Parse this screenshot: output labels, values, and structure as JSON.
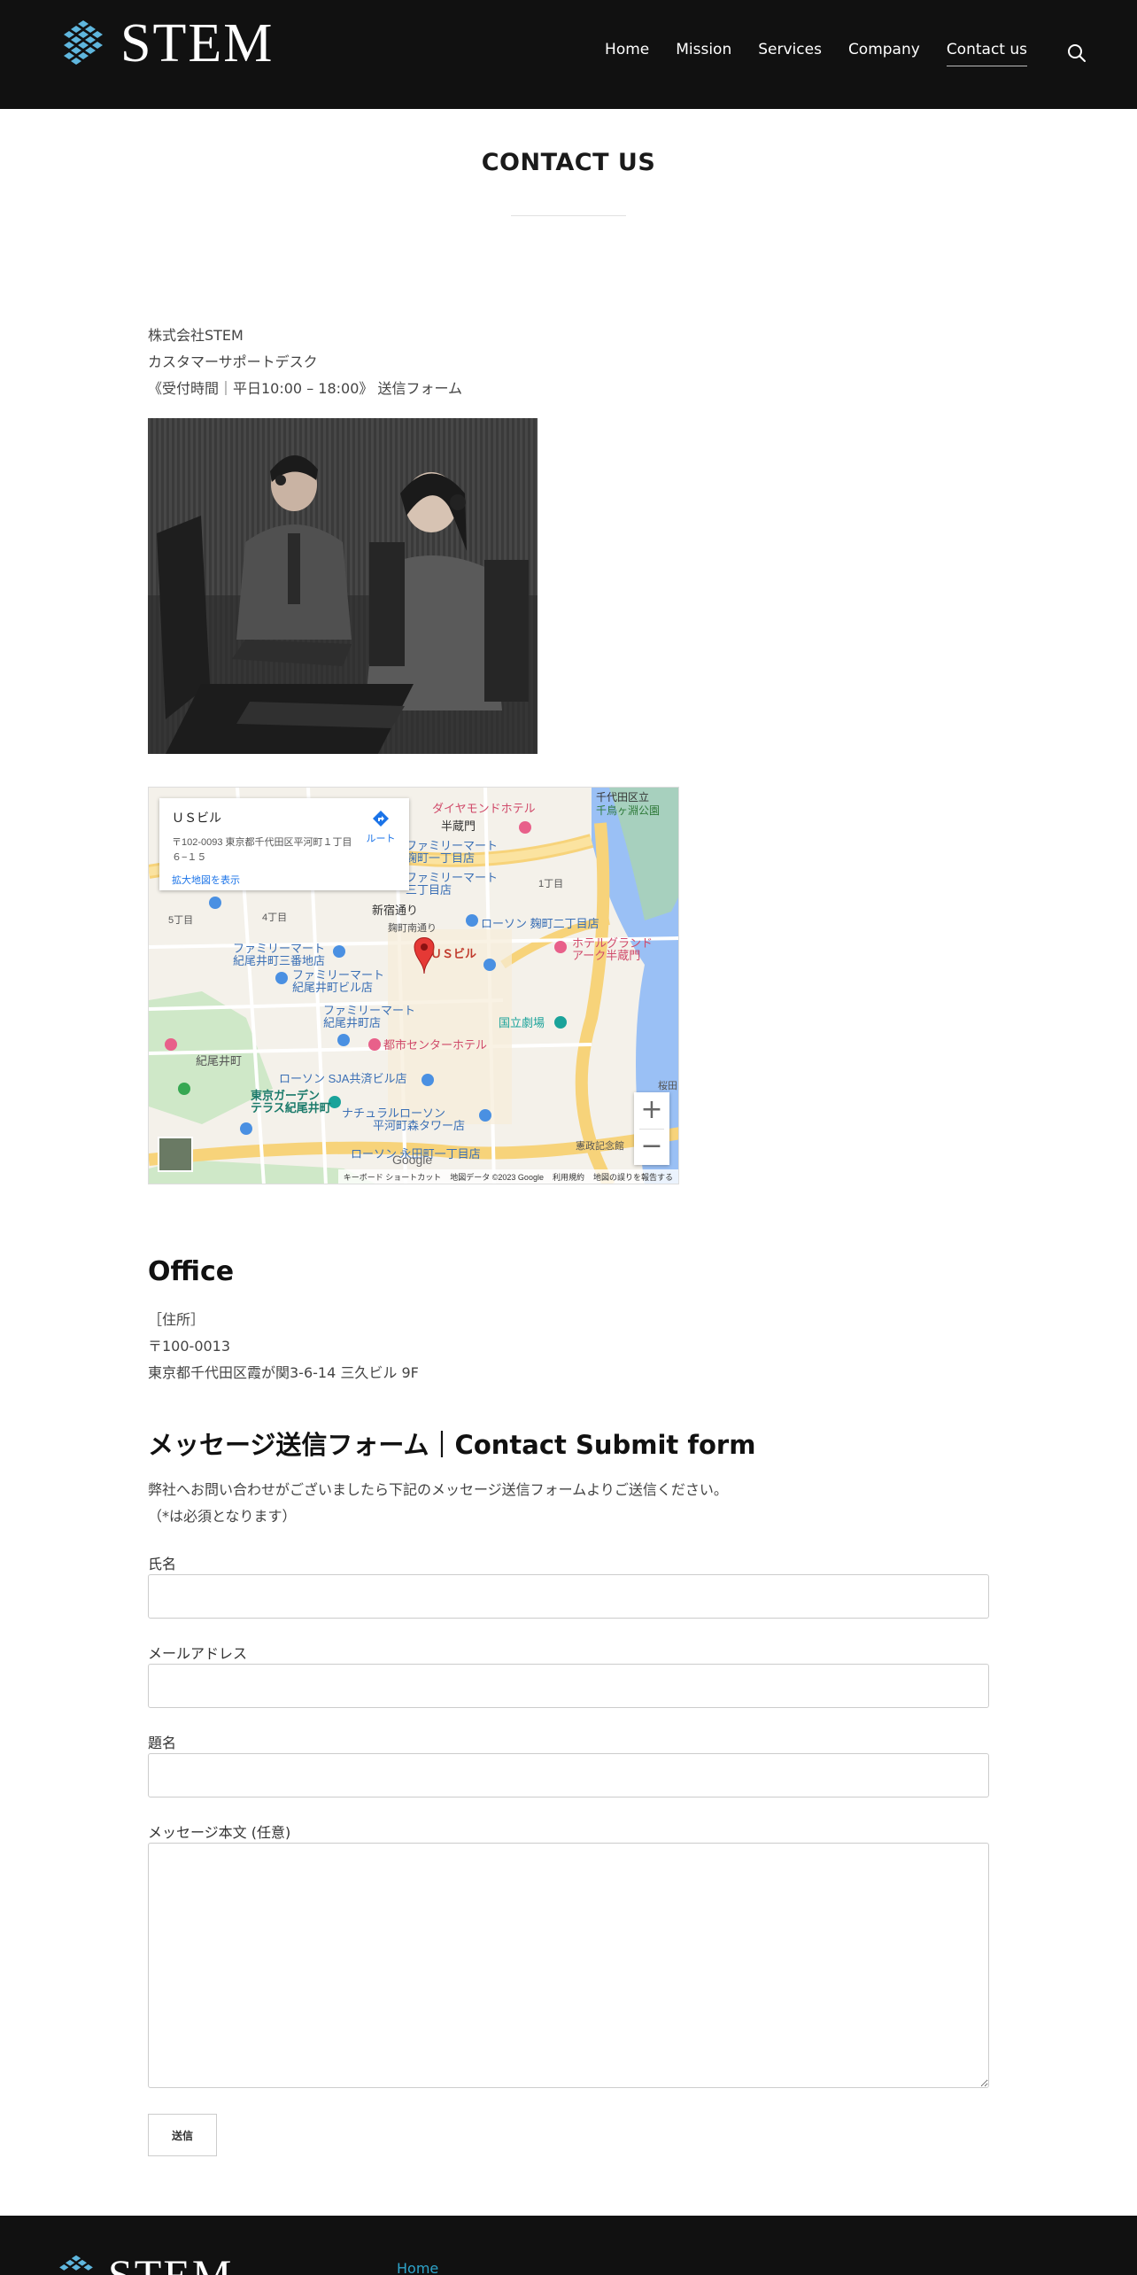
{
  "header": {
    "logo_text": "STEM",
    "nav": [
      {
        "label": "Home"
      },
      {
        "label": "Mission"
      },
      {
        "label": "Services"
      },
      {
        "label": "Company"
      },
      {
        "label": "Contact us",
        "active": true
      }
    ]
  },
  "page": {
    "title": "CONTACT US"
  },
  "intro": {
    "company": "株式会社STEM",
    "desk": "カスタマーサポートデスク",
    "hours": "《受付時間｜平日10:00 – 18:00》 送信フォーム"
  },
  "map": {
    "place_name": "ＵＳビル",
    "address": "〒102-0093 東京都千代田区平河町１丁目６−１５",
    "view_larger": "拡大地図を表示",
    "route": "ルート",
    "pin_label": "ＵＳビル",
    "labels": [
      "ダイヤモンドホテル",
      "半蔵門",
      "千代田区立",
      "千鳥ヶ淵公園",
      "ファミリーマート",
      "麹町一丁目店",
      "ファミリーマート",
      "三丁目店",
      "1丁目",
      "新宿通り",
      "5丁目",
      "4丁目",
      "麹町南通り",
      "ローソン 麹町二丁目店",
      "ホテルグランド",
      "アーク半蔵門",
      "ファミリーマート",
      "紀尾井町三番地店",
      "ファミリーマート",
      "紀尾井町ビル店",
      "ファミリーマート",
      "紀尾井町店",
      "国立劇場",
      "都市センターホテル",
      "紀尾井町",
      "ローソン SJA共済ビル店",
      "東京ガーデン",
      "テラス紀尾井町",
      "ナチュラルローソン",
      "平河町森タワー店",
      "ローソン 永田町一丁目店",
      "憲政記念館",
      "桜田"
    ],
    "footer": [
      "キーボード ショートカット",
      "地図データ ©2023 Google",
      "利用規約",
      "地図の誤りを報告する"
    ],
    "google": "Google"
  },
  "office": {
    "title": "Office",
    "label": "［住所］",
    "postal": "〒100-0013",
    "address": "東京都千代田区霞が関3-6-14 三久ビル 9F"
  },
  "form": {
    "title": "メッセージ送信フォーム｜Contact Submit form",
    "desc1": "弊社へお問い合わせがございましたら下記のメッセージ送信フォームよりご送信ください。",
    "desc2": "（*は必須となります）",
    "name_label": "氏名",
    "name_value": "",
    "email_label": "メールアドレス",
    "email_value": "",
    "subject_label": "題名",
    "subject_value": "",
    "message_label": "メッセージ本文 (任意)",
    "message_value": "",
    "submit_label": "送信"
  },
  "footer": {
    "logo_text": "STEM",
    "home_link": "Home"
  },
  "colors": {
    "header_bg": "#111111",
    "logo_cube": "#5fb6dd",
    "link": "#2ea3c9",
    "map_pin": "#e53935"
  }
}
